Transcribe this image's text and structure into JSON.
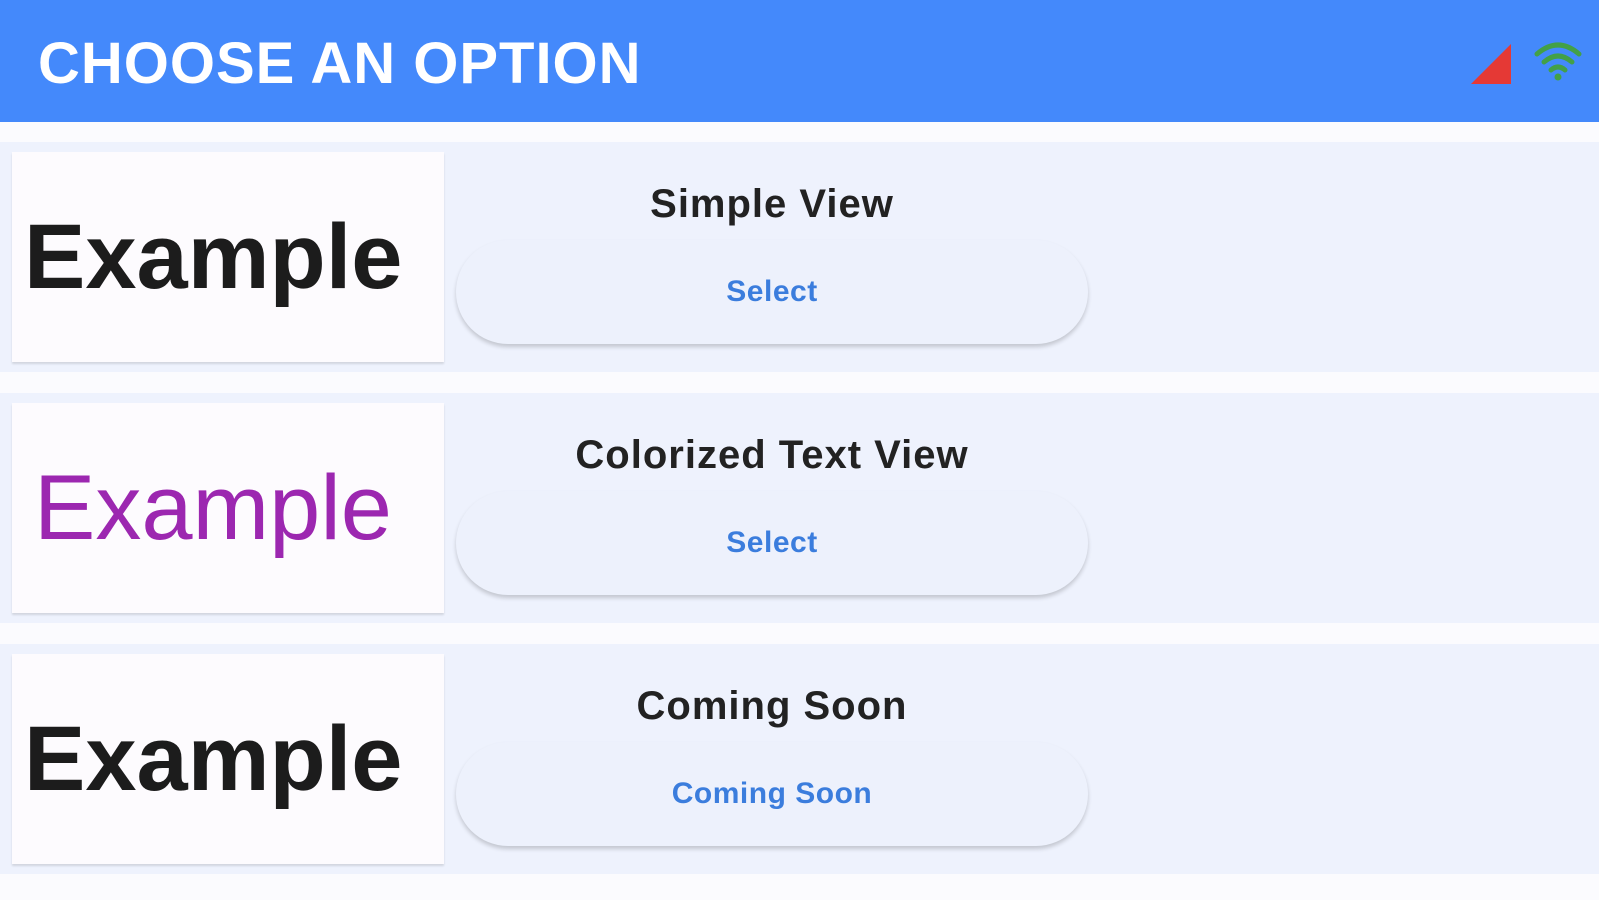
{
  "header": {
    "title": "CHOOSE AN OPTION",
    "signal_icon": "cellular-signal-icon",
    "wifi_icon": "wifi-icon",
    "colors": {
      "background": "#4489fb",
      "signal": "#e53935",
      "wifi": "#43a047"
    }
  },
  "options": [
    {
      "preview_text": "Example",
      "preview_color": "#1c1c1c",
      "title": "Simple View",
      "button_label": "Select"
    },
    {
      "preview_text": "Example",
      "preview_color": "#9c27b0",
      "title": "Colorized Text View",
      "button_label": "Select"
    },
    {
      "preview_text": "Example",
      "preview_color": "#1c1c1c",
      "title": "Coming Soon",
      "button_label": "Coming Soon"
    }
  ],
  "colors": {
    "card_background": "#eef2fd",
    "button_text": "#3b7ddd"
  }
}
